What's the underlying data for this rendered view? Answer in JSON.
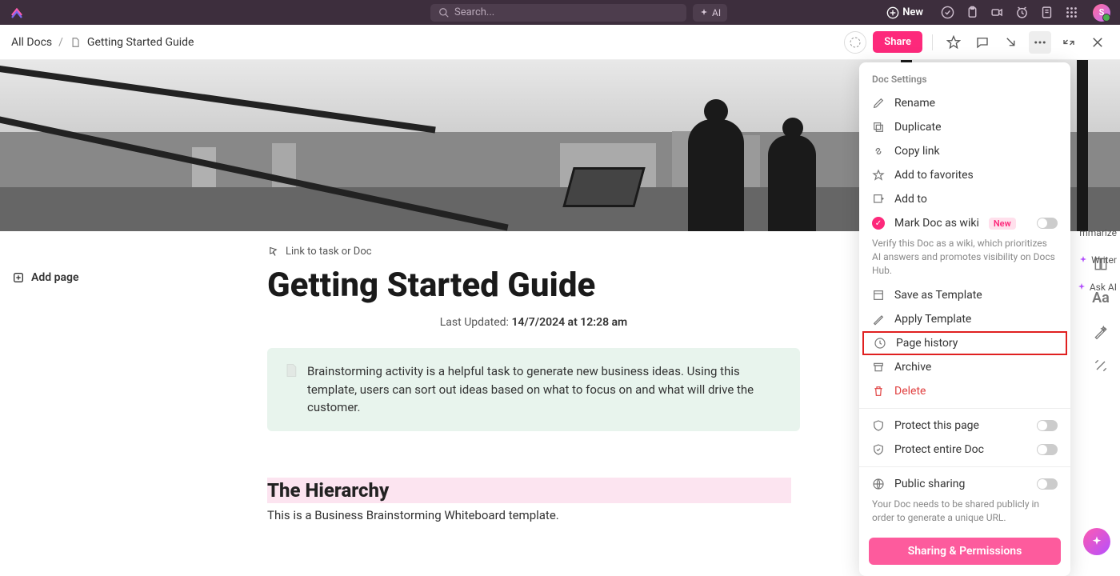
{
  "topbar": {
    "search_placeholder": "Search...",
    "ai_label": "AI",
    "new_label": "New",
    "avatar_letter": "S"
  },
  "breadcrumb": {
    "root": "All Docs",
    "current": "Getting Started Guide"
  },
  "secondbar": {
    "share_label": "Share"
  },
  "leftcol": {
    "add_page": "Add page"
  },
  "main": {
    "link_task": "Link to task or Doc",
    "title": "Getting Started Guide",
    "updated_label": "Last Updated:",
    "updated_value": "14/7/2024 at 12:28 am",
    "callout": "Brainstorming activity is a helpful task to generate new business ideas. Using this template, users can sort out ideas based on what to focus on and what will drive the customer.",
    "h2": "The Hierarchy",
    "body": "This is a Business Brainstorming Whiteboard template."
  },
  "panel": {
    "title": "Doc Settings",
    "rename": "Rename",
    "duplicate": "Duplicate",
    "copylink": "Copy link",
    "add_fav": "Add to favorites",
    "add_to": "Add to",
    "mark_wiki": "Mark Doc as wiki",
    "new_badge": "New",
    "wiki_desc": "Verify this Doc as a wiki, which prioritizes AI answers and promotes visibility on Docs Hub.",
    "save_tpl": "Save as Template",
    "apply_tpl": "Apply Template",
    "history": "Page history",
    "archive": "Archive",
    "delete": "Delete",
    "protect_page": "Protect this page",
    "protect_doc": "Protect entire Doc",
    "public": "Public sharing",
    "public_desc": "Your Doc needs to be shared publicly in order to generate a unique URL.",
    "sharing_btn": "Sharing & Permissions"
  },
  "rail": {
    "summarize": "mmarize",
    "writer": "Writer",
    "ask": "Ask AI"
  }
}
